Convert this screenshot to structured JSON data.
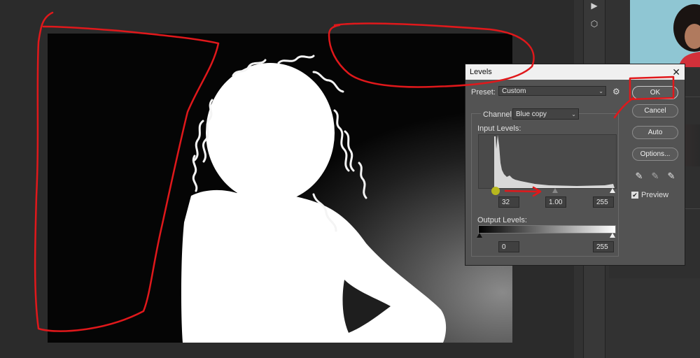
{
  "dialog": {
    "title": "Levels",
    "close_glyph": "✕",
    "preset_label": "Preset:",
    "preset_value": "Custom",
    "channel_label": "Channel:",
    "channel_value": "Blue copy",
    "input_levels_label": "Input Levels:",
    "input_black": "32",
    "input_gamma": "1.00",
    "input_white": "255",
    "output_levels_label": "Output Levels:",
    "output_black": "0",
    "output_white": "255",
    "buttons": {
      "ok": "OK",
      "cancel": "Cancel",
      "auto": "Auto",
      "options": "Options..."
    },
    "preview_label": "Preview",
    "preview_checked": true,
    "icons": [
      "gear-icon",
      "black-point-eyedropper-icon",
      "gray-point-eyedropper-icon",
      "white-point-eyedropper-icon"
    ]
  },
  "toolbar_icons": [
    "play-icon",
    "3d-cube-icon"
  ],
  "colors": {
    "annotation": "#e0181b",
    "highlight_marker": "#b8b81e",
    "dialog_bg": "#535353",
    "workspace_bg": "#2b2b2b"
  }
}
